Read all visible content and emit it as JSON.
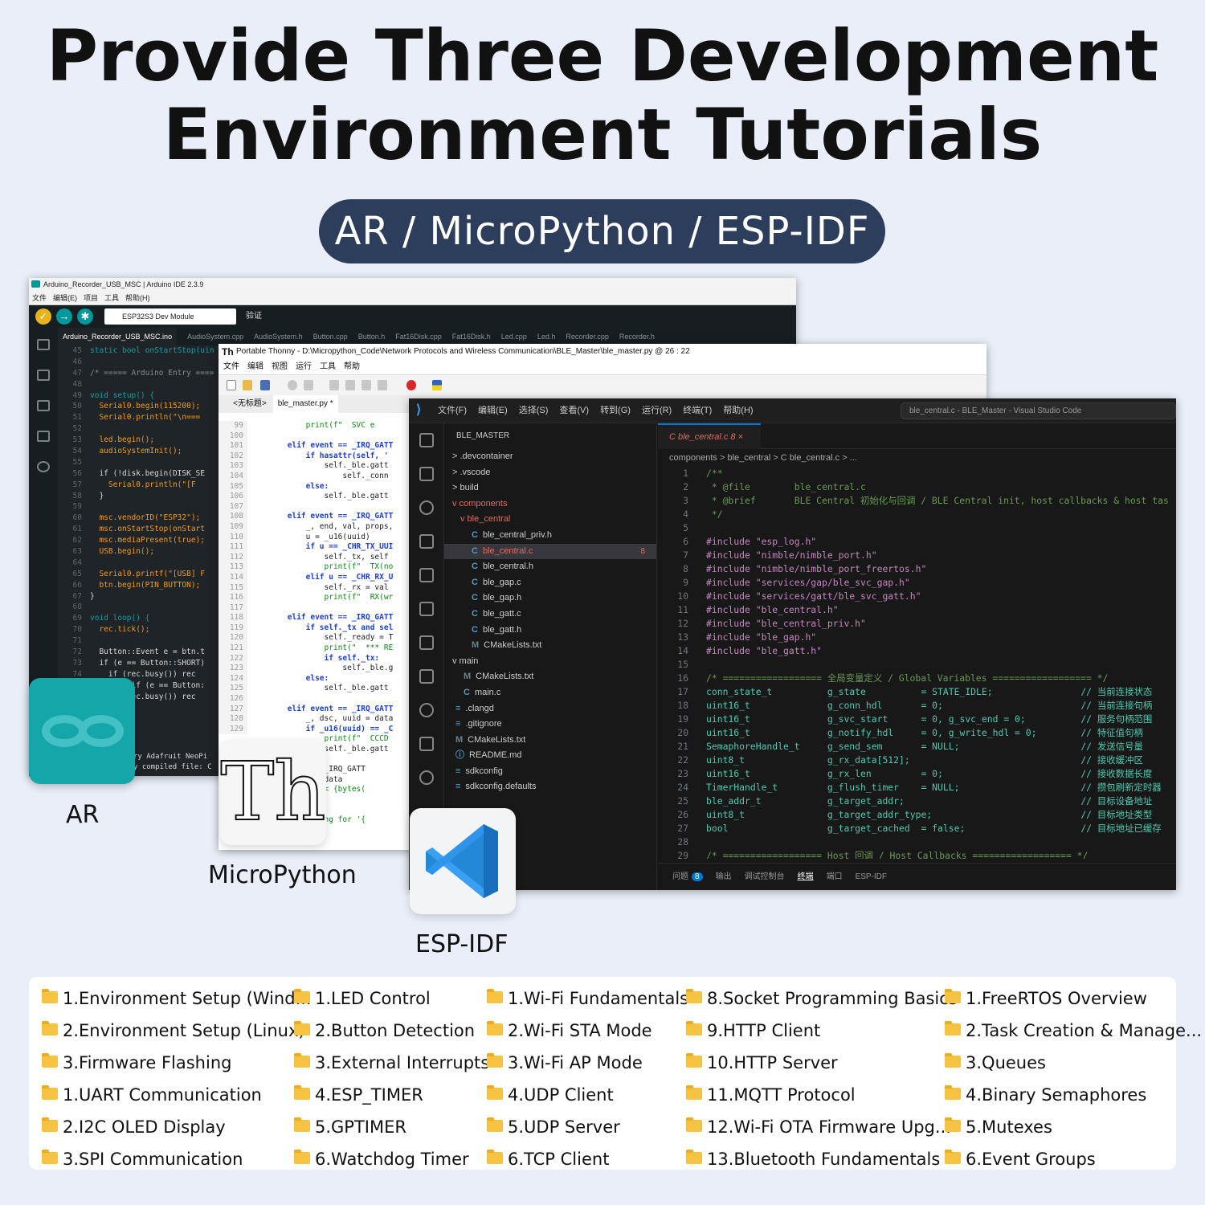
{
  "title": {
    "line1": "Provide Three Development",
    "line2": "Environment Tutorials"
  },
  "subtitle": "AR / MicroPython / ESP-IDF",
  "arduino": {
    "window_title": "Arduino_Recorder_USB_MSC | Arduino IDE 2.3.9",
    "menu": [
      "文件",
      "编辑(E)",
      "项目",
      "工具",
      "帮助(H)"
    ],
    "board": "ESP32S3 Dev Module",
    "verify_label": "验证",
    "tabs": [
      "Arduino_Recorder_USB_MSC.ino",
      "AudioSystem.cpp",
      "AudioSystem.h",
      "Button.cpp",
      "Button.h",
      "Fat16Disk.cpp",
      "Fat16Disk.h",
      "Led.cpp",
      "Led.h",
      "Recorder.cpp",
      "Recorder.h"
    ],
    "code": [
      {
        "n": "45",
        "t": "static bool onStartStop(uin"
      },
      {
        "n": "46",
        "t": ""
      },
      {
        "n": "47",
        "t": "/* ===== Arduino Entry ===="
      },
      {
        "n": "48",
        "t": ""
      },
      {
        "n": "49",
        "t": "void setup() {"
      },
      {
        "n": "50",
        "t": "  Serial0.begin(115200);"
      },
      {
        "n": "51",
        "t": "  Serial0.println(\"\\n==="
      },
      {
        "n": "52",
        "t": ""
      },
      {
        "n": "53",
        "t": "  led.begin();"
      },
      {
        "n": "54",
        "t": "  audioSystemInit();"
      },
      {
        "n": "55",
        "t": ""
      },
      {
        "n": "56",
        "t": "  if (!disk.begin(DISK_SE"
      },
      {
        "n": "57",
        "t": "    Serial0.println(\"[F"
      },
      {
        "n": "58",
        "t": "  }"
      },
      {
        "n": "59",
        "t": ""
      },
      {
        "n": "60",
        "t": "  msc.vendorID(\"ESP32\");"
      },
      {
        "n": "61",
        "t": "  msc.onStartStop(onStart"
      },
      {
        "n": "62",
        "t": "  msc.mediaPresent(true);"
      },
      {
        "n": "63",
        "t": "  USB.begin();"
      },
      {
        "n": "64",
        "t": ""
      },
      {
        "n": "65",
        "t": "  Serial0.printf(\"[USB] F"
      },
      {
        "n": "66",
        "t": "  btn.begin(PIN_BUTTON);"
      },
      {
        "n": "67",
        "t": "}"
      },
      {
        "n": "68",
        "t": ""
      },
      {
        "n": "69",
        "t": "void loop() {"
      },
      {
        "n": "70",
        "t": "  rec.tick();"
      },
      {
        "n": "71",
        "t": ""
      },
      {
        "n": "72",
        "t": "  Button::Event e = btn.t"
      },
      {
        "n": "73",
        "t": "  if (e == Button::SHORT)"
      },
      {
        "n": "74",
        "t": "    if (rec.busy()) rec"
      },
      {
        "n": "75",
        "t": "  } else if (e == Button:"
      },
      {
        "n": "76",
        "t": "    if (rec.busy()) rec"
      }
    ],
    "output": [
      "ry  Adafruit NeoPi",
      "y compiled file: C"
    ]
  },
  "thonny": {
    "window_title": "Portable Thonny  -  D:\\Micropython_Code\\Network Protocols and Wireless Communication\\BLE_Master\\ble_master.py  @  26 : 22",
    "menu": [
      "文件",
      "编辑",
      "视图",
      "运行",
      "工具",
      "帮助"
    ],
    "tabs": [
      "<无标题>",
      "ble_master.py *"
    ],
    "code": [
      {
        "n": "99",
        "t": "            print(f\"  SVC e"
      },
      {
        "n": "100",
        "t": ""
      },
      {
        "n": "101",
        "t": "        elif event == _IRQ_GATT"
      },
      {
        "n": "102",
        "t": "            if hasattr(self, '"
      },
      {
        "n": "103",
        "t": "                self._ble.gatt"
      },
      {
        "n": "104",
        "t": "                    self._conn"
      },
      {
        "n": "105",
        "t": "            else:"
      },
      {
        "n": "106",
        "t": "                self._ble.gatt"
      },
      {
        "n": "107",
        "t": ""
      },
      {
        "n": "108",
        "t": "        elif event == _IRQ_GATT"
      },
      {
        "n": "109",
        "t": "            _, end, val, props,"
      },
      {
        "n": "110",
        "t": "            u = _u16(uuid)"
      },
      {
        "n": "111",
        "t": "            if u == _CHR_TX_UUI"
      },
      {
        "n": "112",
        "t": "                self._tx, self"
      },
      {
        "n": "113",
        "t": "                print(f\"  TX(no"
      },
      {
        "n": "114",
        "t": "            elif u == _CHR_RX_U"
      },
      {
        "n": "115",
        "t": "                self._rx = val"
      },
      {
        "n": "116",
        "t": "                print(f\"  RX(wr"
      },
      {
        "n": "117",
        "t": ""
      },
      {
        "n": "118",
        "t": "        elif event == _IRQ_GATT"
      },
      {
        "n": "119",
        "t": "            if self._tx and sel"
      },
      {
        "n": "120",
        "t": "                self._ready = T"
      },
      {
        "n": "121",
        "t": "                print(\"  *** RE"
      },
      {
        "n": "122",
        "t": "                if self._tx:"
      },
      {
        "n": "123",
        "t": "                    self._ble.g"
      },
      {
        "n": "124",
        "t": "            else:"
      },
      {
        "n": "125",
        "t": "                self._ble.gatt"
      },
      {
        "n": "126",
        "t": ""
      },
      {
        "n": "127",
        "t": "        elif event == _IRQ_GATT"
      },
      {
        "n": "128",
        "t": "            _, dsc, uuid = data"
      },
      {
        "n": "129",
        "t": "            if _u16(uuid) == _C"
      },
      {
        "n": "",
        "t": "                print(f\"  CCCD"
      },
      {
        "n": "",
        "t": "                self._ble.gatt"
      },
      {
        "n": "",
        "t": ""
      },
      {
        "n": "",
        "t": "        vent == _IRQ_GATT"
      },
      {
        "n": "",
        "t": "        _, nd = data"
      },
      {
        "n": "",
        "t": "        int(f\"<<< {bytes("
      },
      {
        "n": "",
        "t": ""
      },
      {
        "n": "",
        "t": "        (self):"
      },
      {
        "n": "",
        "t": "        f\"Scanning for '{"
      }
    ]
  },
  "vscode": {
    "menu": [
      "文件(F)",
      "编辑(E)",
      "选择(S)",
      "查看(V)",
      "转到(G)",
      "运行(R)",
      "终端(T)",
      "帮助(H)"
    ],
    "search": "ble_central.c - BLE_Master - Visual Studio Code",
    "explorer_title": "BLE_MASTER",
    "explorer": [
      {
        "label": "> .devcontainer",
        "indent": 1,
        "type": "folder"
      },
      {
        "label": "> .vscode",
        "indent": 1,
        "type": "folder"
      },
      {
        "label": "> build",
        "indent": 1,
        "type": "folder"
      },
      {
        "label": "v components",
        "indent": 1,
        "type": "folder-red"
      },
      {
        "label": "v ble_central",
        "indent": 2,
        "type": "folder-red"
      },
      {
        "label": "ble_central_priv.h",
        "indent": 3,
        "type": "c"
      },
      {
        "label": "ble_central.c",
        "indent": 3,
        "type": "c-sel",
        "badge": "8"
      },
      {
        "label": "ble_central.h",
        "indent": 3,
        "type": "c"
      },
      {
        "label": "ble_gap.c",
        "indent": 3,
        "type": "c"
      },
      {
        "label": "ble_gap.h",
        "indent": 3,
        "type": "c"
      },
      {
        "label": "ble_gatt.c",
        "indent": 3,
        "type": "c"
      },
      {
        "label": "ble_gatt.h",
        "indent": 3,
        "type": "c"
      },
      {
        "label": "CMakeLists.txt",
        "indent": 3,
        "type": "m"
      },
      {
        "label": "v main",
        "indent": 1,
        "type": "folder"
      },
      {
        "label": "CMakeLists.txt",
        "indent": 2,
        "type": "m"
      },
      {
        "label": "main.c",
        "indent": 2,
        "type": "c"
      },
      {
        "label": ".clangd",
        "indent": 1,
        "type": "file"
      },
      {
        "label": ".gitignore",
        "indent": 1,
        "type": "file"
      },
      {
        "label": "CMakeLists.txt",
        "indent": 1,
        "type": "m"
      },
      {
        "label": "README.md",
        "indent": 1,
        "type": "info"
      },
      {
        "label": "sdkconfig",
        "indent": 1,
        "type": "file"
      },
      {
        "label": "sdkconfig.defaults",
        "indent": 1,
        "type": "file"
      }
    ],
    "tab": "C  ble_central.c  8  ×",
    "breadcrumb": "components > ble_central > C  ble_central.c > ...",
    "code": [
      {
        "n": "1",
        "t": "/**"
      },
      {
        "n": "2",
        "t": " * @file        ble_central.c"
      },
      {
        "n": "3",
        "t": " * @brief       BLE Central 初始化与回调 / BLE Central init, host callbacks & host tas"
      },
      {
        "n": "4",
        "t": " */"
      },
      {
        "n": "5",
        "t": ""
      },
      {
        "n": "6",
        "t": "#include \"esp_log.h\""
      },
      {
        "n": "7",
        "t": "#include \"nimble/nimble_port.h\""
      },
      {
        "n": "8",
        "t": "#include \"nimble/nimble_port_freertos.h\""
      },
      {
        "n": "9",
        "t": "#include \"services/gap/ble_svc_gap.h\""
      },
      {
        "n": "10",
        "t": "#include \"services/gatt/ble_svc_gatt.h\""
      },
      {
        "n": "11",
        "t": "#include \"ble_central.h\""
      },
      {
        "n": "12",
        "t": "#include \"ble_central_priv.h\""
      },
      {
        "n": "13",
        "t": "#include \"ble_gap.h\""
      },
      {
        "n": "14",
        "t": "#include \"ble_gatt.h\""
      },
      {
        "n": "15",
        "t": ""
      },
      {
        "n": "16",
        "t": "/* ================== 全局变量定义 / Global Variables ================== */"
      },
      {
        "n": "17",
        "t": "conn_state_t          g_state          = STATE_IDLE;                // 当前连接状态"
      },
      {
        "n": "18",
        "t": "uint16_t              g_conn_hdl       = 0;                         // 当前连接句柄"
      },
      {
        "n": "19",
        "t": "uint16_t              g_svc_start      = 0, g_svc_end = 0;          // 服务句柄范围"
      },
      {
        "n": "20",
        "t": "uint16_t              g_notify_hdl     = 0, g_write_hdl = 0;        // 特征值句柄"
      },
      {
        "n": "21",
        "t": "SemaphoreHandle_t     g_send_sem       = NULL;                      // 发送信号量"
      },
      {
        "n": "22",
        "t": "uint8_t               g_rx_data[512];                               // 接收缓冲区"
      },
      {
        "n": "23",
        "t": "uint16_t              g_rx_len         = 0;                         // 接收数据长度"
      },
      {
        "n": "24",
        "t": "TimerHandle_t         g_flush_timer    = NULL;                      // 攒包刷新定时器"
      },
      {
        "n": "25",
        "t": "ble_addr_t            g_target_addr;                                // 目标设备地址"
      },
      {
        "n": "26",
        "t": "uint8_t               g_target_addr_type;                           // 目标地址类型"
      },
      {
        "n": "27",
        "t": "bool                  g_target_cached  = false;                     // 目标地址已缓存"
      },
      {
        "n": "28",
        "t": ""
      },
      {
        "n": "29",
        "t": "/* ================== Host 回调 / Host Callbacks ================== */"
      }
    ],
    "panel": [
      "问题",
      "8",
      "输出",
      "调试控制台",
      "终端",
      "端口",
      "ESP-IDF"
    ]
  },
  "apps": [
    {
      "label": "AR",
      "icon": "arduino-icon"
    },
    {
      "label": "MicroPython",
      "icon": "thonny-icon"
    },
    {
      "label": "ESP-IDF",
      "icon": "vscode-icon"
    }
  ],
  "tutorials": [
    [
      "1.Environment Setup (Wind...",
      "2.Environment Setup (Linux)",
      "3.Firmware Flashing",
      "1.UART Communication",
      "2.I2C OLED Display",
      "3.SPI Communication"
    ],
    [
      "1.LED Control",
      "2.Button Detection",
      "3.External Interrupts",
      "4.ESP_TIMER",
      "5.GPTIMER",
      "6.Watchdog Timer"
    ],
    [
      "1.Wi-Fi Fundamentals",
      "2.Wi-Fi STA Mode",
      "3.Wi-Fi AP Mode",
      "4.UDP Client",
      "5.UDP Server",
      "6.TCP Client"
    ],
    [
      "8.Socket Programming Basics",
      "9.HTTP Client",
      "10.HTTP Server",
      "11.MQTT Protocol",
      "12.Wi-Fi OTA Firmware Upg...",
      "13.Bluetooth Fundamentals"
    ],
    [
      "1.FreeRTOS Overview",
      "2.Task Creation & Manage...",
      "3.Queues",
      "4.Binary Semaphores",
      "5.Mutexes",
      "6.Event Groups"
    ]
  ]
}
